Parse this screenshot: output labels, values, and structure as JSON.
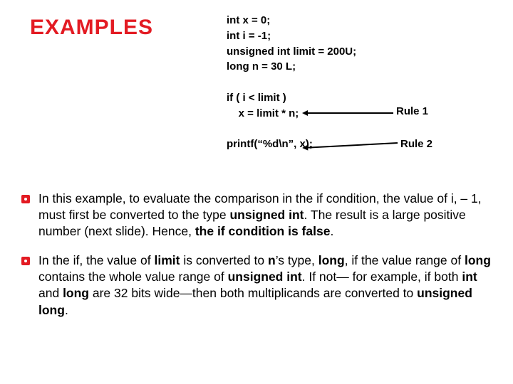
{
  "title": "EXAMPLES",
  "code": {
    "line1": "int x = 0;",
    "line2": "int i = -1;",
    "line3": "unsigned int limit = 200U;",
    "line4": "long n = 30 L;",
    "blank1": "",
    "line5": "if ( i < limit )",
    "line6": "    x = limit * n;",
    "blank2": "",
    "line7": "printf(“%d\\n”, x);"
  },
  "rules": {
    "r1": "Rule 1",
    "r2": "Rule 2"
  },
  "para1": {
    "t1": "In this example, to evaluate the comparison in the if condition, the value of i, – 1, must first be converted to the type ",
    "b1": "unsigned int",
    "t2": ". The result is a large positive number (next slide). Hence, ",
    "b2": "the if condition is false",
    "t3": "."
  },
  "para2": {
    "t1": "In the if, the value of ",
    "b1": "limit",
    "t2": " is converted to ",
    "b2": "n",
    "t3": "’s type, ",
    "b3": "long",
    "t4": ", if the value range of ",
    "b4": "long",
    "t5": " contains the whole value range of ",
    "b5": "unsigned int",
    "t6": ". If not— for example, if both ",
    "b6": "int",
    "t7": " and ",
    "b7": "long",
    "t8": " are 32 bits wide—then both multiplicands are converted to ",
    "b8": "unsigned long",
    "t9": "."
  }
}
